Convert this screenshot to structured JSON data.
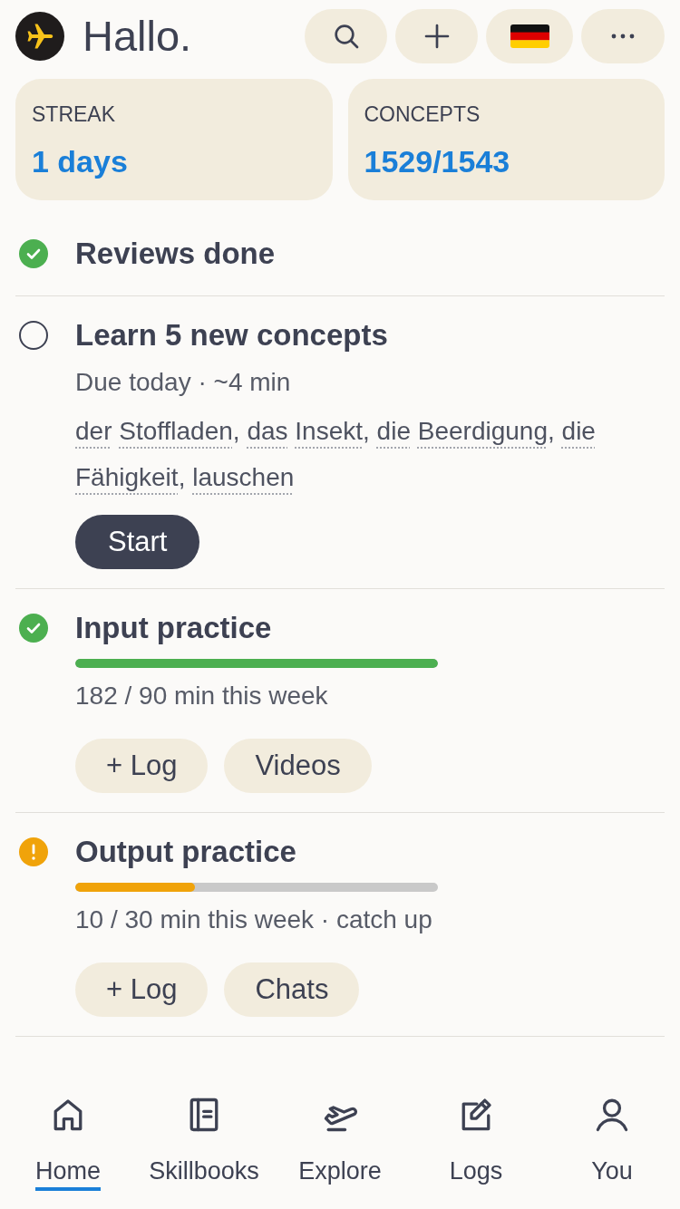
{
  "header": {
    "title": "Hallo."
  },
  "stats": [
    {
      "label": "STREAK",
      "value": "1 days"
    },
    {
      "label": "CONCEPTS",
      "value": "1529/1543"
    }
  ],
  "tasks": [
    {
      "kind": "done",
      "title": "Reviews done"
    },
    {
      "kind": "pending",
      "title": "Learn 5 new concepts",
      "meta": "Due today · ~4 min",
      "concepts": {
        "items": [
          "der Stoffladen",
          "das Insekt",
          "die Beerdigung",
          "die Fähigkeit",
          "lauschen"
        ],
        "separator": ", "
      },
      "buttons": [
        {
          "label": "Start",
          "kind": "primary"
        }
      ]
    },
    {
      "kind": "done",
      "title": "Input practice",
      "progress": {
        "level": 1
      },
      "meta": "182 / 90 min this week",
      "buttons": [
        {
          "label": "+ Log",
          "kind": "secondary"
        },
        {
          "label": "Videos",
          "kind": "secondary"
        }
      ]
    },
    {
      "kind": "warning",
      "title": "Output practice",
      "progress": {
        "level": 0.33
      },
      "meta": "10 / 30 min this week · catch up",
      "buttons": [
        {
          "label": "+ Log",
          "kind": "secondary"
        },
        {
          "label": "Chats",
          "kind": "secondary"
        }
      ]
    }
  ],
  "nav": [
    {
      "label": "Home",
      "selected": true
    },
    {
      "label": "Skillbooks",
      "selected": false
    },
    {
      "label": "Explore",
      "selected": false
    },
    {
      "label": "Logs",
      "selected": false
    },
    {
      "label": "You",
      "selected": false
    }
  ]
}
